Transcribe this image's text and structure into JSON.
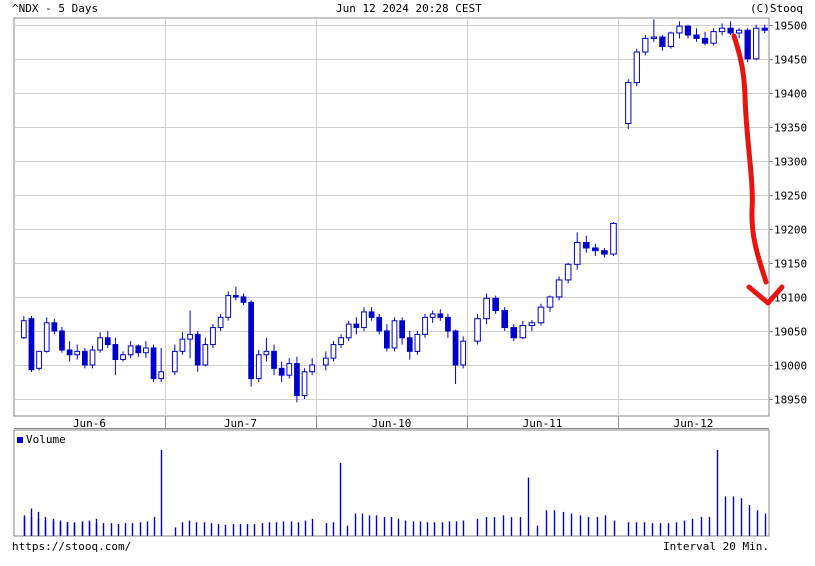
{
  "header": {
    "ticker": "^NDX - 5 Days",
    "timestamp": "Jun 12 2024 20:28 CEST",
    "copyright": "(C)Stooq"
  },
  "footer": {
    "url": "https://stooq.com/",
    "interval": "Interval 20 Min."
  },
  "volume_legend": "Volume",
  "colors": {
    "candle": "#0000cc",
    "grid": "#d0d0d0",
    "annotation": "#e8140f"
  },
  "chart_data": [
    {
      "type": "candlestick",
      "title": "^NDX - 5 Days",
      "x": [
        "Jun-6",
        "Jun-7",
        "Jun-10",
        "Jun-11",
        "Jun-12"
      ],
      "ylim": [
        18925,
        19510
      ],
      "y_ticks": [
        18950,
        19000,
        19050,
        19100,
        19150,
        19200,
        19250,
        19300,
        19350,
        19400,
        19450,
        19500
      ],
      "grid": true,
      "series": [
        {
          "day": "Jun-6",
          "bars": [
            [
              19040,
              19072,
              19038,
              19065
            ],
            [
              19068,
              19072,
              18990,
              18993
            ],
            [
              18995,
              19020,
              18992,
              19020
            ],
            [
              19020,
              19070,
              19018,
              19062
            ],
            [
              19062,
              19068,
              19045,
              19050
            ],
            [
              19050,
              19056,
              19018,
              19022
            ],
            [
              19022,
              19035,
              19005,
              19015
            ],
            [
              19015,
              19030,
              19008,
              19020
            ],
            [
              19020,
              19025,
              18995,
              19000
            ],
            [
              19000,
              19028,
              18995,
              19022
            ],
            [
              19022,
              19048,
              19018,
              19040
            ],
            [
              19040,
              19050,
              19025,
              19030
            ],
            [
              19030,
              19040,
              18985,
              19008
            ],
            [
              19008,
              19020,
              19005,
              19015
            ],
            [
              19015,
              19035,
              19010,
              19028
            ],
            [
              19028,
              19030,
              19012,
              19018
            ],
            [
              19018,
              19035,
              19010,
              19025
            ],
            [
              19025,
              19030,
              18975,
              18980
            ],
            [
              18980,
              19025,
              18975,
              18990
            ]
          ]
        },
        {
          "day": "Jun-7",
          "bars": [
            [
              18990,
              19030,
              18985,
              19020
            ],
            [
              19020,
              19048,
              19015,
              19038
            ],
            [
              19038,
              19080,
              19010,
              19045
            ],
            [
              19045,
              19050,
              18990,
              19000
            ],
            [
              19000,
              19040,
              18998,
              19030
            ],
            [
              19030,
              19060,
              19025,
              19055
            ],
            [
              19055,
              19075,
              19050,
              19070
            ],
            [
              19070,
              19108,
              19065,
              19102
            ],
            [
              19102,
              19115,
              19095,
              19100
            ],
            [
              19100,
              19105,
              19088,
              19092
            ],
            [
              19092,
              19095,
              18968,
              18980
            ],
            [
              18980,
              19022,
              18975,
              19015
            ],
            [
              19015,
              19040,
              19005,
              19020
            ],
            [
              19020,
              19030,
              18985,
              18995
            ],
            [
              18995,
              19005,
              18975,
              18985
            ],
            [
              18985,
              19010,
              18980,
              19002
            ],
            [
              19002,
              19012,
              18945,
              18955
            ],
            [
              18955,
              18995,
              18950,
              18990
            ],
            [
              18990,
              19010,
              18985,
              19000
            ]
          ]
        },
        {
          "day": "Jun-10",
          "bars": [
            [
              19000,
              19020,
              18992,
              19010
            ],
            [
              19010,
              19035,
              19005,
              19030
            ],
            [
              19030,
              19045,
              19025,
              19040
            ],
            [
              19040,
              19065,
              19035,
              19060
            ],
            [
              19060,
              19070,
              19045,
              19055
            ],
            [
              19055,
              19085,
              19050,
              19078
            ],
            [
              19078,
              19085,
              19065,
              19070
            ],
            [
              19070,
              19075,
              19045,
              19050
            ],
            [
              19050,
              19060,
              19020,
              19025
            ],
            [
              19025,
              19070,
              19020,
              19065
            ],
            [
              19065,
              19070,
              19030,
              19040
            ],
            [
              19040,
              19050,
              19008,
              19020
            ],
            [
              19020,
              19050,
              19015,
              19045
            ],
            [
              19045,
              19075,
              19040,
              19070
            ],
            [
              19070,
              19080,
              19062,
              19075
            ],
            [
              19075,
              19082,
              19065,
              19070
            ],
            [
              19070,
              19075,
              19040,
              19050
            ],
            [
              19050,
              19052,
              18972,
              19000
            ],
            [
              19000,
              19042,
              18995,
              19035
            ]
          ]
        },
        {
          "day": "Jun-11",
          "bars": [
            [
              19035,
              19075,
              19030,
              19068
            ],
            [
              19068,
              19105,
              19060,
              19098
            ],
            [
              19098,
              19102,
              19075,
              19080
            ],
            [
              19080,
              19085,
              19050,
              19055
            ],
            [
              19055,
              19060,
              19035,
              19040
            ],
            [
              19040,
              19065,
              19038,
              19058
            ],
            [
              19058,
              19066,
              19050,
              19062
            ],
            [
              19062,
              19090,
              19058,
              19085
            ],
            [
              19085,
              19102,
              19078,
              19100
            ],
            [
              19100,
              19130,
              19095,
              19125
            ],
            [
              19125,
              19150,
              19120,
              19148
            ],
            [
              19148,
              19195,
              19140,
              19180
            ],
            [
              19180,
              19190,
              19165,
              19172
            ],
            [
              19172,
              19178,
              19160,
              19168
            ],
            [
              19168,
              19172,
              19158,
              19163
            ],
            [
              19163,
              19210,
              19160,
              19208
            ]
          ]
        },
        {
          "day": "Jun-12",
          "bars": [
            [
              19355,
              19420,
              19347,
              19415
            ],
            [
              19415,
              19465,
              19410,
              19460
            ],
            [
              19460,
              19485,
              19455,
              19480
            ],
            [
              19480,
              19508,
              19475,
              19482
            ],
            [
              19482,
              19485,
              19462,
              19468
            ],
            [
              19468,
              19490,
              19465,
              19488
            ],
            [
              19488,
              19505,
              19480,
              19498
            ],
            [
              19498,
              19500,
              19480,
              19485
            ],
            [
              19485,
              19495,
              19475,
              19480
            ],
            [
              19480,
              19490,
              19470,
              19473
            ],
            [
              19473,
              19495,
              19470,
              19490
            ],
            [
              19490,
              19502,
              19485,
              19495
            ],
            [
              19495,
              19505,
              19485,
              19488
            ],
            [
              19488,
              19495,
              19480,
              19492
            ],
            [
              19492,
              19495,
              19445,
              19450
            ],
            [
              19450,
              19500,
              19448,
              19495
            ],
            [
              19495,
              19500,
              19488,
              19492
            ]
          ]
        }
      ]
    },
    {
      "type": "bar",
      "title": "Volume",
      "grid": false,
      "series": [
        {
          "name": "Volume",
          "values": [
            0.22,
            0.32,
            0.28,
            0.22,
            0.2,
            0.18,
            0.16,
            0.15,
            0.16,
            0.16,
            0.15,
            0.15,
            0.15,
            0.14,
            0.15,
            0.15,
            0.16,
            0.17,
            0.22,
            1.0,
            0.1,
            0.16,
            0.18,
            0.16,
            0.16,
            0.15,
            0.14,
            0.13,
            0.14,
            0.14,
            0.14,
            0.14,
            0.15,
            0.16,
            0.16,
            0.17,
            0.17,
            0.16,
            0.18,
            0.2,
            0.15,
            0.16,
            0.85,
            0.12,
            0.26,
            0.26,
            0.24,
            0.24,
            0.22,
            0.22,
            0.2,
            0.18,
            0.17,
            0.17,
            0.16,
            0.16,
            0.16,
            0.17,
            0.17,
            0.18,
            0.2,
            0.22,
            0.22,
            0.24,
            0.22,
            0.22,
            0.68,
            0.12,
            0.3,
            0.3,
            0.28,
            0.26,
            0.24,
            0.22,
            0.22,
            0.24,
            0.18,
            0.16,
            0.16,
            0.16,
            0.15,
            0.15,
            0.15,
            0.16,
            0.18,
            0.2,
            0.22,
            0.22,
            1.0,
            0.46,
            0.46,
            0.44,
            0.36,
            0.3,
            0.26,
            0.24,
            0.22,
            0.2,
            0.18,
            0.17,
            0.16,
            0.16,
            0.16,
            0.17,
            0.18,
            0.2
          ]
        }
      ]
    }
  ]
}
